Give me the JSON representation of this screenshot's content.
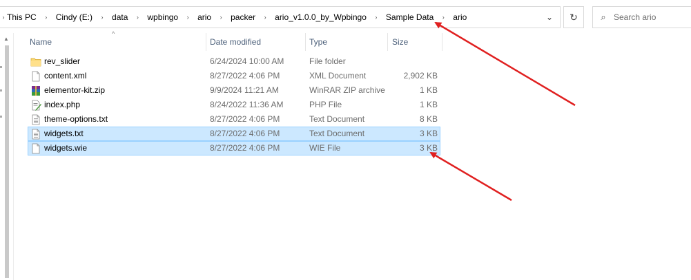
{
  "breadcrumb": [
    "This PC",
    "Cindy (E:)",
    "data",
    "wpbingo",
    "ario",
    "packer",
    "ario_v1.0.0_by_Wpbingo",
    "Sample Data",
    "ario"
  ],
  "search": {
    "placeholder": "Search ario"
  },
  "columns": {
    "name": "Name",
    "date": "Date modified",
    "type": "Type",
    "size": "Size"
  },
  "files": [
    {
      "name": "rev_slider",
      "date": "6/24/2024 10:00 AM",
      "type": "File folder",
      "size": "",
      "icon": "folder-icon",
      "selected": false
    },
    {
      "name": "content.xml",
      "date": "8/27/2022 4:06 PM",
      "type": "XML Document",
      "size": "2,902 KB",
      "icon": "xml-file-icon",
      "selected": false
    },
    {
      "name": "elementor-kit.zip",
      "date": "9/9/2024 11:21 AM",
      "type": "WinRAR ZIP archive",
      "size": "1 KB",
      "icon": "winrar-archive-icon",
      "selected": false
    },
    {
      "name": "index.php",
      "date": "8/24/2022 11:36 AM",
      "type": "PHP File",
      "size": "1 KB",
      "icon": "php-file-icon",
      "selected": false
    },
    {
      "name": "theme-options.txt",
      "date": "8/27/2022 4:06 PM",
      "type": "Text Document",
      "size": "8 KB",
      "icon": "text-file-icon",
      "selected": false
    },
    {
      "name": "widgets.txt",
      "date": "8/27/2022 4:06 PM",
      "type": "Text Document",
      "size": "3 KB",
      "icon": "text-file-icon",
      "selected": true
    },
    {
      "name": "widgets.wie",
      "date": "8/27/2022 4:06 PM",
      "type": "WIE File",
      "size": "3 KB",
      "icon": "blank-file-icon",
      "selected": true
    }
  ],
  "colors": {
    "selection_bg": "#cce8ff",
    "selection_border": "#99d1ff",
    "annotation_arrow": "#e02020",
    "header_text": "#4c607a"
  }
}
